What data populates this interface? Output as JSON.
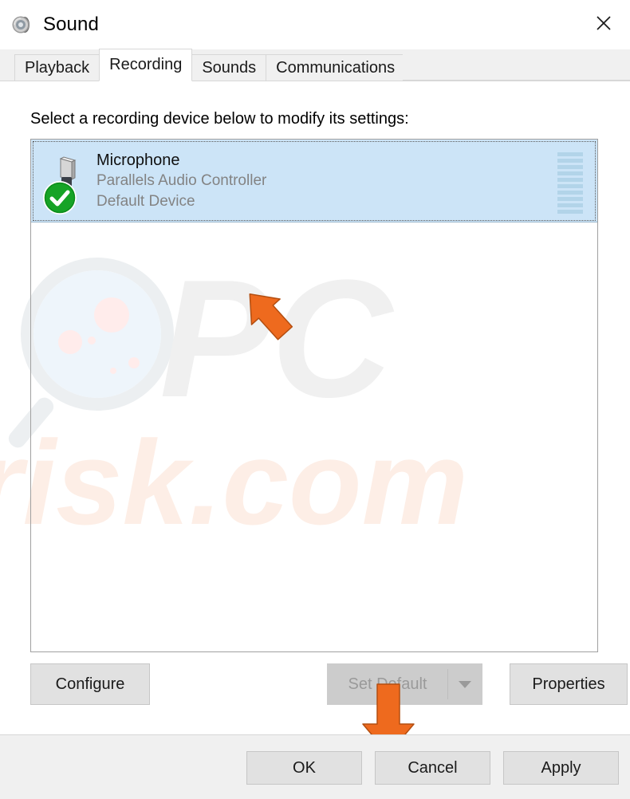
{
  "window": {
    "title": "Sound",
    "title_icon": "speaker-icon",
    "close_label": "close-icon"
  },
  "tabs": [
    {
      "label": "Playback",
      "active": false
    },
    {
      "label": "Recording",
      "active": true
    },
    {
      "label": "Sounds",
      "active": false
    },
    {
      "label": "Communications",
      "active": false
    }
  ],
  "recording_panel": {
    "instruction": "Select a recording device below to modify its settings:",
    "devices": [
      {
        "name": "Microphone",
        "controller": "Parallels Audio Controller",
        "status": "Default Device",
        "selected": true,
        "icon": "microphone-icon",
        "badge": "green-check-icon",
        "meter_segments": 10,
        "meter_level": 0
      }
    ]
  },
  "mid_buttons": {
    "configure": "Configure",
    "set_default": "Set Default",
    "set_default_disabled": true,
    "set_default_dropdown": "chevron-down-icon",
    "properties": "Properties"
  },
  "footer_buttons": {
    "ok": "OK",
    "cancel": "Cancel",
    "apply": "Apply",
    "apply_disabled": true
  },
  "watermark": {
    "text": "PCrisk.com",
    "logo": "magnifier-icon"
  },
  "annotations": [
    {
      "name": "arrow-pointing-at-device",
      "direction": "up-left",
      "color": "#ee6a1e"
    },
    {
      "name": "arrow-pointing-at-set-default",
      "direction": "down",
      "color": "#ee6a1e"
    }
  ],
  "colors": {
    "accent": "#0078d7",
    "selection": "#cce4f7",
    "annotation": "#ee6a1e",
    "default_badge": "#1faa28",
    "disabled_text": "#9a9a9a"
  }
}
